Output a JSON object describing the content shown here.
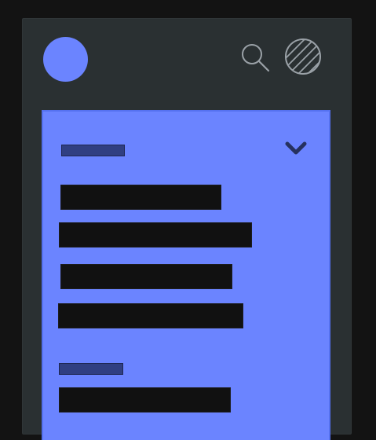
{
  "header": {
    "avatar_icon": "avatar",
    "search_icon": "search-icon",
    "profile_icon": "profile-icon",
    "accent": "#6b84ff",
    "background": "#2a3032"
  },
  "panel": {
    "background": "#6b84ff",
    "sections": [
      {
        "title": "",
        "expanded": true,
        "items": [
          "",
          "",
          "",
          ""
        ]
      },
      {
        "title": "",
        "items": [
          ""
        ]
      }
    ]
  },
  "colors": {
    "page": "#131313",
    "item": "#111111",
    "section_title": "#303f82"
  }
}
